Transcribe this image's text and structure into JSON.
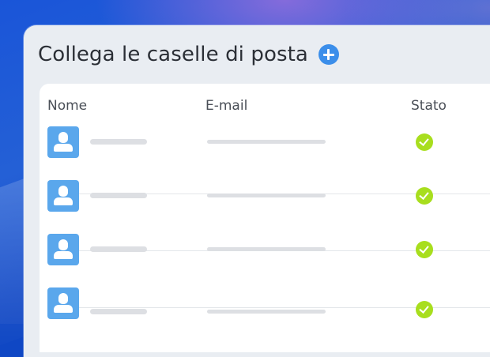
{
  "page": {
    "title": "Collega le caselle di posta"
  },
  "table": {
    "headers": {
      "name": "Nome",
      "email": "E-mail",
      "status": "Stato"
    },
    "rows": [
      {
        "avatar": "user-placeholder-icon",
        "name": "",
        "email": "",
        "status": "connected"
      },
      {
        "avatar": "user-placeholder-icon",
        "name": "",
        "email": "",
        "status": "connected"
      },
      {
        "avatar": "user-placeholder-icon",
        "name": "",
        "email": "",
        "status": "connected"
      },
      {
        "avatar": "user-placeholder-icon",
        "name": "",
        "email": "",
        "status": "connected"
      }
    ]
  },
  "icons": {
    "add": "plus-circle-icon",
    "status": "check-circle-icon"
  },
  "colors": {
    "accent": "#3b8eea",
    "avatar": "#5aa7ec",
    "status_ok": "#a8de1e",
    "background": "#1a55d8"
  }
}
